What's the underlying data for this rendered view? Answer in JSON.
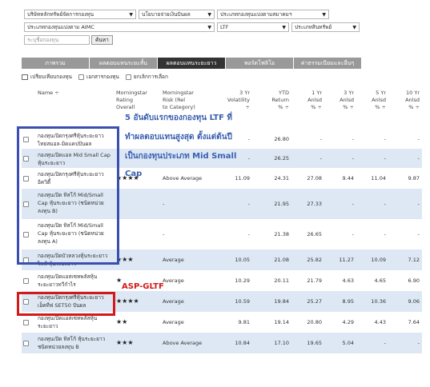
{
  "filters": {
    "company": "บริษัทหลักทรัพย์จัดการกองทุน",
    "policy": "นโยบายจ่ายเงินปันผล",
    "type_by_association": "ประเภทกองทุนแบ่งตามสมาคมฯ",
    "aimc_type": "ประเภทกองทุนแบ่งตาม AIMC",
    "tax_type": "LTF",
    "asset_type": "ประเภทสินทรัพย์",
    "search_placeholder": "ระบุชื่อกองทุน",
    "search_button": "ค้นหา"
  },
  "tabs": [
    "ภาพรวม",
    "ผลตอบแทนระยะสั้น",
    "ผลตอบแทนระยะยาว",
    "พอร์ตโฟลิโอ",
    "ค่าธรรมเนียมและอื่นๆ"
  ],
  "toolbar": {
    "compare": "เปรียบเทียบกองทุน",
    "export": "เอกสารกองทุน",
    "clear": "ยกเลิกการเลือก"
  },
  "headers": {
    "name": "Name ÷",
    "rating": [
      "Morningstar",
      "Rating",
      "Overall"
    ],
    "risk": [
      "Morningstar",
      "Risk (Rel",
      "to Category)"
    ],
    "vol": [
      "3 Yr",
      "Volatility",
      "÷"
    ],
    "ytd": [
      "YTD",
      "Return",
      "% ÷"
    ],
    "y1": [
      "1 Yr",
      "Anlsd",
      "% ÷"
    ],
    "y3": [
      "3 Yr",
      "Anlsd",
      "% ÷"
    ],
    "y5": [
      "5 Yr",
      "Anlsd",
      "% ÷"
    ],
    "y10": [
      "10 Yr",
      "Anlsd",
      "% ÷"
    ]
  },
  "rows": [
    {
      "name": [
        "กองทุนเปิดกรุงศรีหุ้นระยะยาว",
        "ไทยสมอล-มิดแคปปันผล"
      ],
      "stars": "",
      "risk": "",
      "vol": "-",
      "ytd": "26.80",
      "y1": "-",
      "y3": "-",
      "y5": "-",
      "y10": "-"
    },
    {
      "name": [
        "กองทุนเปิดแอล Mid Small Cap",
        "หุ้นระยะยาว"
      ],
      "stars": "",
      "risk": "",
      "vol": "-",
      "ytd": "26.25",
      "y1": "-",
      "y3": "-",
      "y5": "-",
      "y10": "-"
    },
    {
      "name": [
        "กองทุนเปิดกรุงศรีหุ้นระยะยาว",
        "อิควิตี้"
      ],
      "stars": "★★★★",
      "risk": "Above Average",
      "vol": "11.09",
      "ytd": "24.31",
      "y1": "27.08",
      "y3": "9.44",
      "y5": "11.04",
      "y10": "9.87"
    },
    {
      "name": [
        "กองทุนเปิด ทิสโก้ Mid/Small",
        "Cap หุ้นระยะยาว (ชนิดหน่วย",
        "ลงทุน B)"
      ],
      "stars": "",
      "risk": "-",
      "vol": "-",
      "ytd": "21.95",
      "y1": "27.33",
      "y3": "-",
      "y5": "-",
      "y10": "-"
    },
    {
      "name": [
        "กองทุนเปิด ทิสโก้ Mid/Small",
        "Cap หุ้นระยะยาว (ชนิดหน่วย",
        "ลงทุน A)"
      ],
      "stars": "",
      "risk": "-",
      "vol": "-",
      "ytd": "21.38",
      "y1": "26.65",
      "y3": "-",
      "y5": "-",
      "y10": "-"
    },
    {
      "name": [
        "กองทุนเปิดบัวหลวงหุ้นระยะยาว",
        "ไลฟ์ หุ้นระยะยาว"
      ],
      "stars": "★★★",
      "risk": "Average",
      "vol": "10.05",
      "ytd": "21.08",
      "y1": "25.82",
      "y3": "11.27",
      "y5": "10.09",
      "y10": "7.12"
    },
    {
      "name": [
        "กองทุนเปิดแอสเซทพลัสหุ้น",
        "ระยะยาวทวีกำไร"
      ],
      "stars": "★",
      "risk": "Average",
      "vol": "10.29",
      "ytd": "20.11",
      "y1": "21.79",
      "y3": "4.63",
      "y5": "4.65",
      "y10": "6.90"
    },
    {
      "name": [
        "กองทุนเปิดกรุงศรีหุ้นระยะยาว",
        "เอ็คทีฟ SET50 ปันผล"
      ],
      "stars": "★★★★",
      "risk": "Average",
      "vol": "10.59",
      "ytd": "19.84",
      "y1": "25.27",
      "y3": "8.95",
      "y5": "10.36",
      "y10": "9.06"
    },
    {
      "name": [
        "กองทุนเปิดแอสเซทพลัสหุ้น",
        "ระยะยาว"
      ],
      "stars": "★★",
      "risk": "Average",
      "vol": "9.81",
      "ytd": "19.14",
      "y1": "20.80",
      "y3": "4.29",
      "y5": "4.43",
      "y10": "7.64"
    },
    {
      "name": [
        "กองทุนเปิด ทิสโก้ หุ้นระยะยาว",
        "ชนิดหน่วยลงทุน B"
      ],
      "stars": "★★★",
      "risk": "Above Average",
      "vol": "10.84",
      "ytd": "17.10",
      "y1": "19.65",
      "y3": "5.04",
      "y5": "-",
      "y10": "-"
    }
  ],
  "annotations": {
    "blue_line1": "5 อันดับแรกของกองทุน LTF ที่",
    "blue_line2": "ทำผลตอบแทนสูงสุด ตั้งแต่ต้นปี",
    "blue_line3": "เป็นกองทุนประเภท Mid Small",
    "blue_line4": "Cap",
    "red_label": "ASP-GLTF",
    "blue_color": "#3a4fb0",
    "red_color": "#d21a1a"
  }
}
